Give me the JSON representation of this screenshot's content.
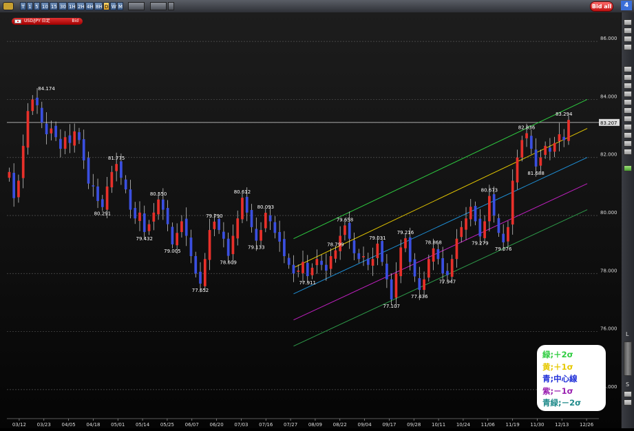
{
  "toolbar": {
    "timeframes": [
      "T",
      "1",
      "5",
      "10",
      "15",
      "30",
      "1H",
      "2H",
      "4H",
      "8H",
      "D",
      "W",
      "M"
    ],
    "active_timeframe": "D",
    "bid_all_label": "Bid all",
    "panel_number": "4"
  },
  "symbol_tag": {
    "name": "USD/JPY 日足",
    "side": "Bid"
  },
  "legend": [
    {
      "text": "緑;＋2σ",
      "color": "#2ecc40"
    },
    {
      "text": "黄;＋1σ",
      "color": "#e6c800"
    },
    {
      "text": "青;中心線",
      "color": "#1f2fd8"
    },
    {
      "text": "紫;－1σ",
      "color": "#9a1fb0"
    },
    {
      "text": "青緑;－2σ",
      "color": "#1f8a8a"
    }
  ],
  "sidebar": {
    "zoom_labels": [
      "L",
      "S"
    ]
  },
  "chart_data": {
    "type": "candlestick",
    "title": "",
    "ylim": [
      73,
      87
    ],
    "y_ticks": [
      74,
      76,
      78,
      80,
      82,
      84,
      86
    ],
    "y_tick_labels": [
      "74.000",
      "76.000",
      "78.000",
      "80.000",
      "82.000",
      "84.000",
      "86.000"
    ],
    "x_tick_labels": [
      "03/12",
      "03/23",
      "04/05",
      "04/18",
      "05/01",
      "05/14",
      "05/25",
      "06/07",
      "06/20",
      "07/03",
      "07/16",
      "07/27",
      "08/09",
      "08/22",
      "09/04",
      "09/17",
      "09/28",
      "10/11",
      "10/24",
      "11/06",
      "11/19",
      "11/30",
      "12/13",
      "12/26"
    ],
    "current_price_label": "83.207",
    "current_price": 83.207,
    "grid": true,
    "colors": {
      "up": "#e8302a",
      "down": "#3a4fe0"
    },
    "closes": [
      81.5,
      80.6,
      81.2,
      82.4,
      83.6,
      84.0,
      83.8,
      83.2,
      82.8,
      83.0,
      82.7,
      82.3,
      82.7,
      82.5,
      82.9,
      82.6,
      81.9,
      81.1,
      81.0,
      80.5,
      80.291,
      81.0,
      81.5,
      81.775,
      81.3,
      80.9,
      80.2,
      79.9,
      80.1,
      79.432,
      79.7,
      80.1,
      80.55,
      80.2,
      79.7,
      79.005,
      79.4,
      79.8,
      79.3,
      78.6,
      78.0,
      77.652,
      78.5,
      79.5,
      79.79,
      79.5,
      79.2,
      78.609,
      79.3,
      79.9,
      80.612,
      80.1,
      79.6,
      79.133,
      79.5,
      80.093,
      79.8,
      79.4,
      79.1,
      78.6,
      78.3,
      78.0,
      78.1,
      78.4,
      77.911,
      78.2,
      78.5,
      78.3,
      78.1,
      78.6,
      78.799,
      79.3,
      79.658,
      79.2,
      78.7,
      78.5,
      78.6,
      78.3,
      78.5,
      79.031,
      78.4,
      77.8,
      77.107,
      78.0,
      78.9,
      79.216,
      78.4,
      77.9,
      77.436,
      77.8,
      78.5,
      78.868,
      78.5,
      78.0,
      77.947,
      78.5,
      79.2,
      79.6,
      79.9,
      80.3,
      79.8,
      79.279,
      79.8,
      80.673,
      80.0,
      79.4,
      79.076,
      79.6,
      81.2,
      82.0,
      82.6,
      82.836,
      82.3,
      81.688,
      82.0,
      82.4,
      82.2,
      82.5,
      82.8,
      82.6,
      83.294
    ],
    "annotations": [
      {
        "label": "84.174",
        "x": 8,
        "y": 84.174,
        "pos": "above"
      },
      {
        "label": "81.775",
        "x": 23,
        "y": 81.775,
        "pos": "above"
      },
      {
        "label": "80.291",
        "x": 20,
        "y": 80.291,
        "pos": "below"
      },
      {
        "label": "80.550",
        "x": 32,
        "y": 80.55,
        "pos": "above"
      },
      {
        "label": "79.432",
        "x": 29,
        "y": 79.432,
        "pos": "below"
      },
      {
        "label": "79.005",
        "x": 35,
        "y": 79.005,
        "pos": "below"
      },
      {
        "label": "79.790",
        "x": 44,
        "y": 79.79,
        "pos": "above"
      },
      {
        "label": "77.652",
        "x": 41,
        "y": 77.652,
        "pos": "below"
      },
      {
        "label": "78.609",
        "x": 47,
        "y": 78.609,
        "pos": "below"
      },
      {
        "label": "80.612",
        "x": 50,
        "y": 80.612,
        "pos": "above"
      },
      {
        "label": "79.133",
        "x": 53,
        "y": 79.133,
        "pos": "below"
      },
      {
        "label": "80.093",
        "x": 55,
        "y": 80.093,
        "pos": "above"
      },
      {
        "label": "77.911",
        "x": 64,
        "y": 77.911,
        "pos": "below"
      },
      {
        "label": "78.799",
        "x": 70,
        "y": 78.799,
        "pos": "above"
      },
      {
        "label": "79.658",
        "x": 72,
        "y": 79.658,
        "pos": "above"
      },
      {
        "label": "79.031",
        "x": 79,
        "y": 79.031,
        "pos": "above"
      },
      {
        "label": "77.107",
        "x": 82,
        "y": 77.107,
        "pos": "below"
      },
      {
        "label": "79.216",
        "x": 85,
        "y": 79.216,
        "pos": "above"
      },
      {
        "label": "77.436",
        "x": 88,
        "y": 77.436,
        "pos": "below"
      },
      {
        "label": "78.868",
        "x": 91,
        "y": 78.868,
        "pos": "above"
      },
      {
        "label": "77.947",
        "x": 94,
        "y": 77.947,
        "pos": "below"
      },
      {
        "label": "80.673",
        "x": 103,
        "y": 80.673,
        "pos": "above"
      },
      {
        "label": "79.279",
        "x": 101,
        "y": 79.279,
        "pos": "below"
      },
      {
        "label": "79.076",
        "x": 106,
        "y": 79.076,
        "pos": "below"
      },
      {
        "label": "82.836",
        "x": 111,
        "y": 82.836,
        "pos": "above"
      },
      {
        "label": "81.688",
        "x": 113,
        "y": 81.688,
        "pos": "below"
      },
      {
        "label": "83.294",
        "x": 119,
        "y": 83.294,
        "pos": "above"
      }
    ],
    "regression_channel": {
      "start_x": 61,
      "end_x": 124,
      "bands": [
        {
          "name": "+2σ",
          "start": 79.2,
          "end": 84.0,
          "color": "#2ecc40"
        },
        {
          "name": "+1σ",
          "start": 78.2,
          "end": 83.0,
          "color": "#e6c800"
        },
        {
          "name": "中心線",
          "start": 77.3,
          "end": 82.0,
          "color": "#1e90d8"
        },
        {
          "name": "-1σ",
          "start": 76.4,
          "end": 81.1,
          "color": "#c020c0"
        },
        {
          "name": "-2σ",
          "start": 75.5,
          "end": 80.2,
          "color": "#2e9b4a"
        }
      ]
    }
  }
}
